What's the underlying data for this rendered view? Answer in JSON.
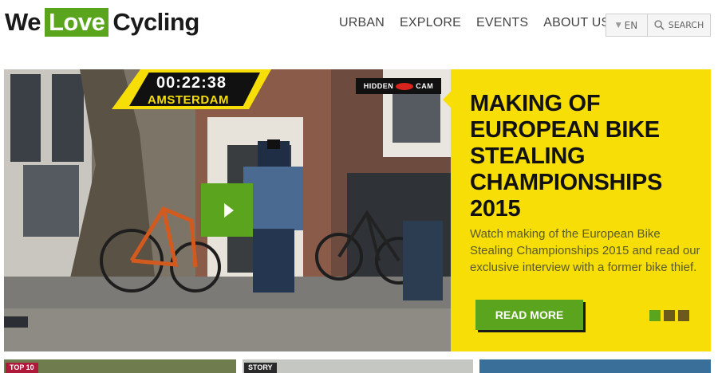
{
  "header": {
    "logo": {
      "left": "We",
      "love": "Love",
      "right": "Cycling"
    },
    "nav": [
      {
        "label": "URBAN"
      },
      {
        "label": "EXPLORE"
      },
      {
        "label": "EVENTS"
      },
      {
        "label": "ABOUT US"
      }
    ],
    "language": "EN",
    "search_label": "SEARCH"
  },
  "hero": {
    "timer": "00:22:38",
    "city": "AMSTERDAM",
    "hidden_cam_left": "HIDDEN",
    "hidden_cam_right": "CAM",
    "title": "MAKING OF EUROPEAN BIKE STEALING CHAMPIONSHIPS 2015",
    "description": "Watch making of the European Bike Stealing Championships 2015 and read our exclusive interview with a former bike thief.",
    "read_more": "READ MORE",
    "slides": 3,
    "active_slide": 1
  },
  "cards": [
    {
      "tag": "TOP 10"
    },
    {
      "tag": "STORY"
    },
    {
      "tag": ""
    }
  ],
  "colors": {
    "accent_green": "#5aa51d",
    "panel_yellow": "#f7de06"
  }
}
